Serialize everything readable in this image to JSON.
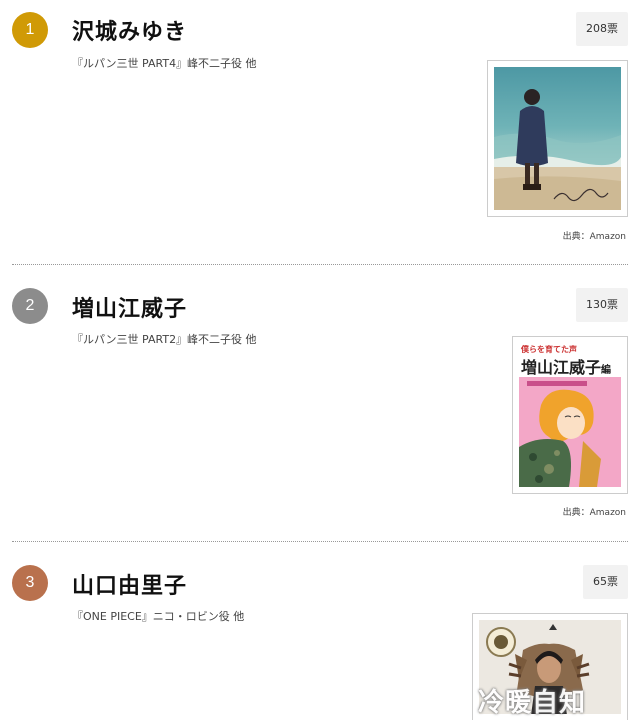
{
  "entries": [
    {
      "rank": "1",
      "badge_color": "#d09a06",
      "name": "沢城みゆき",
      "votes": "208票",
      "role": "『ルパン三世 PART4』峰不二子役 他",
      "source": "出典：Amazon",
      "cover_alt_text": "沢城みゆき"
    },
    {
      "rank": "2",
      "badge_color": "#8c8c8c",
      "name": "増山江威子",
      "votes": "130票",
      "role": "『ルパン三世 PART2』峰不二子役 他",
      "source": "出典：Amazon",
      "cover_heading": "僕らを育てた声",
      "cover_title": "増山江威子",
      "cover_title_suffix": "編"
    },
    {
      "rank": "3",
      "badge_color": "#b9714d",
      "name": "山口由里子",
      "votes": "65票",
      "role": "『ONE PIECE』ニコ・ロビン役 他"
    }
  ],
  "watermark": "冷暖自知"
}
